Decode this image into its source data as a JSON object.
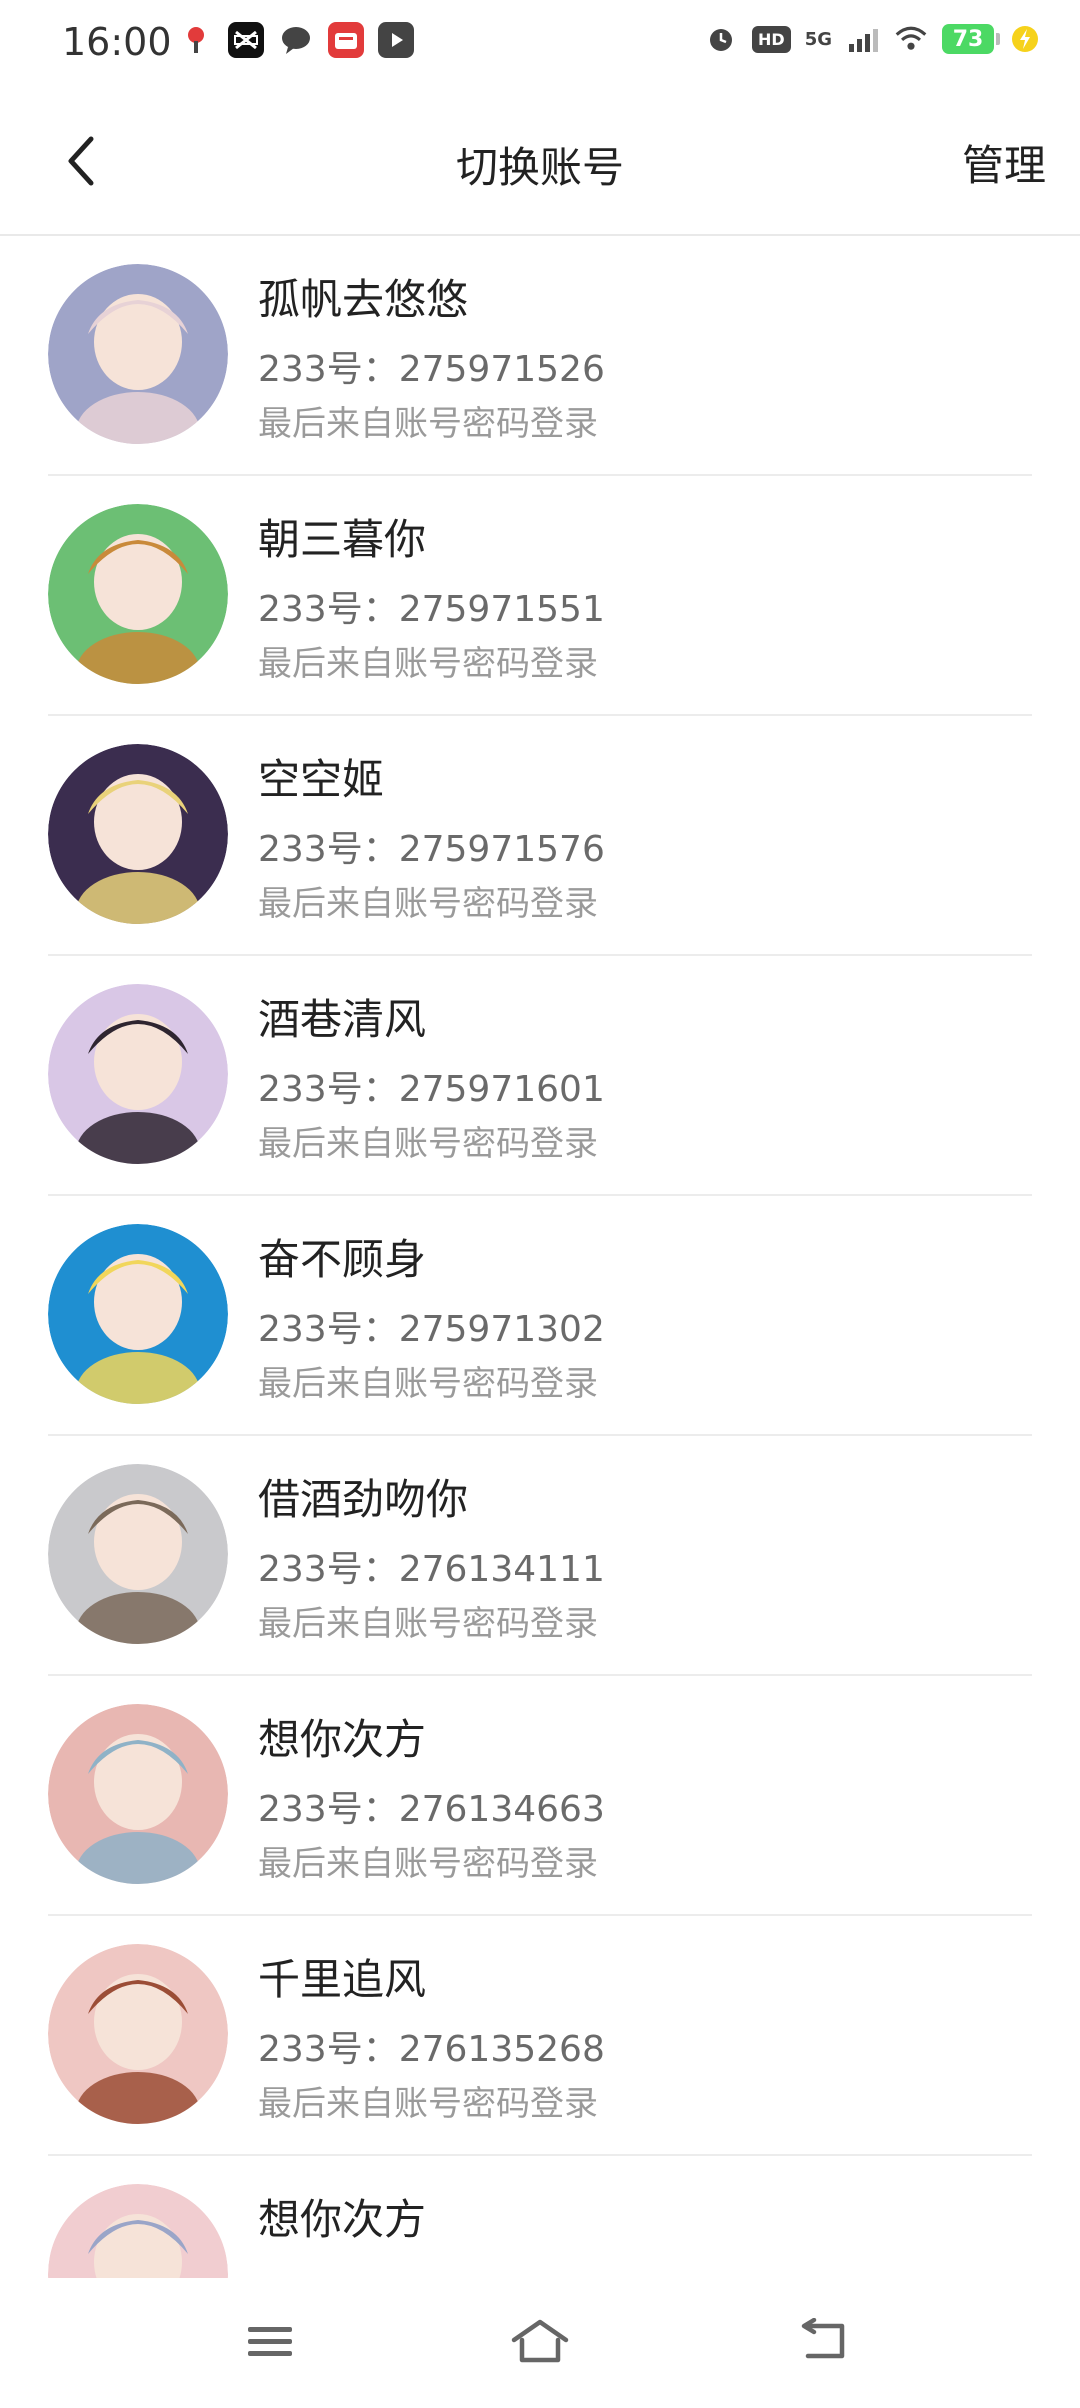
{
  "status": {
    "time": "16:00",
    "battery": "73",
    "network": "5G",
    "hd_label": "HD",
    "app_icons": [
      "map-pin-app",
      "capcut-app",
      "chat-bubble-app",
      "shop-app",
      "video-app"
    ]
  },
  "header": {
    "title": "切换账号",
    "manage_label": "管理"
  },
  "accounts": [
    {
      "name": "孤帆去悠悠",
      "id": "233号：275971526",
      "last": "最后来自账号密码登录",
      "avatar_colors": [
        "#9fa4c8",
        "#e7d2d6"
      ]
    },
    {
      "name": "朝三暮你",
      "id": "233号：275971551",
      "last": "最后来自账号密码登录",
      "avatar_colors": [
        "#6cbf74",
        "#c98a3a"
      ]
    },
    {
      "name": "空空姬",
      "id": "233号：275971576",
      "last": "最后来自账号密码登录",
      "avatar_colors": [
        "#3b2d4f",
        "#e9d27a"
      ]
    },
    {
      "name": "酒巷清风",
      "id": "233号：275971601",
      "last": "最后来自账号密码登录",
      "avatar_colors": [
        "#d9c7e6",
        "#2e2530"
      ]
    },
    {
      "name": "奋不顾身",
      "id": "233号：275971302",
      "last": "最后来自账号密码登录",
      "avatar_colors": [
        "#1f8fd1",
        "#f1d65b"
      ]
    },
    {
      "name": "借酒劲吻你",
      "id": "233号：276134111",
      "last": "最后来自账号密码登录",
      "avatar_colors": [
        "#c9c9cc",
        "#7b6a5a"
      ]
    },
    {
      "name": "想你次方",
      "id": "233号：276134663",
      "last": "最后来自账号密码登录",
      "avatar_colors": [
        "#e8b7b2",
        "#8fb2c7"
      ]
    },
    {
      "name": "千里追风",
      "id": "233号：276135268",
      "last": "最后来自账号密码登录",
      "avatar_colors": [
        "#efc7c3",
        "#9b4d36"
      ]
    },
    {
      "name": "想你次方",
      "id": "",
      "last": "",
      "avatar_colors": [
        "#f1cdd0",
        "#9aa5c8"
      ]
    }
  ]
}
